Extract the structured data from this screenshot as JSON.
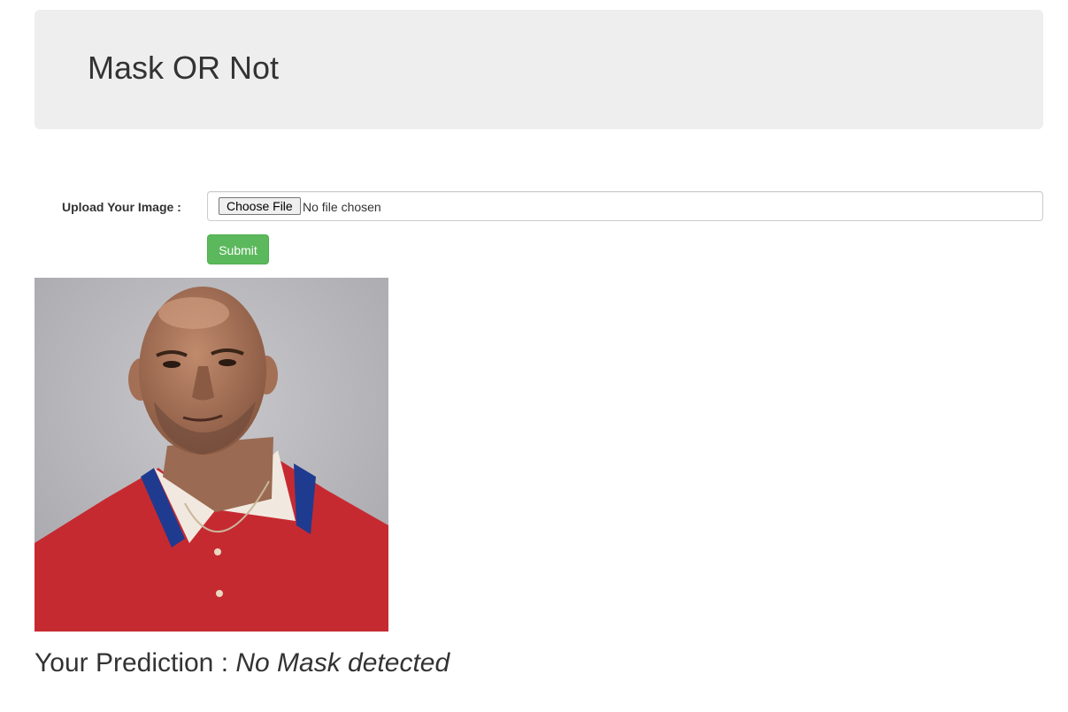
{
  "header": {
    "title": "Mask OR Not"
  },
  "form": {
    "upload_label": "Upload Your Image :",
    "choose_file_label": "Choose File",
    "file_status": "No file chosen",
    "submit_label": "Submit"
  },
  "result": {
    "prediction_prefix": "Your Prediction : ",
    "prediction_value": "No Mask detected"
  },
  "colors": {
    "jumbotron_bg": "#eeeeee",
    "submit_green": "#5cb85c",
    "text": "#333333"
  }
}
